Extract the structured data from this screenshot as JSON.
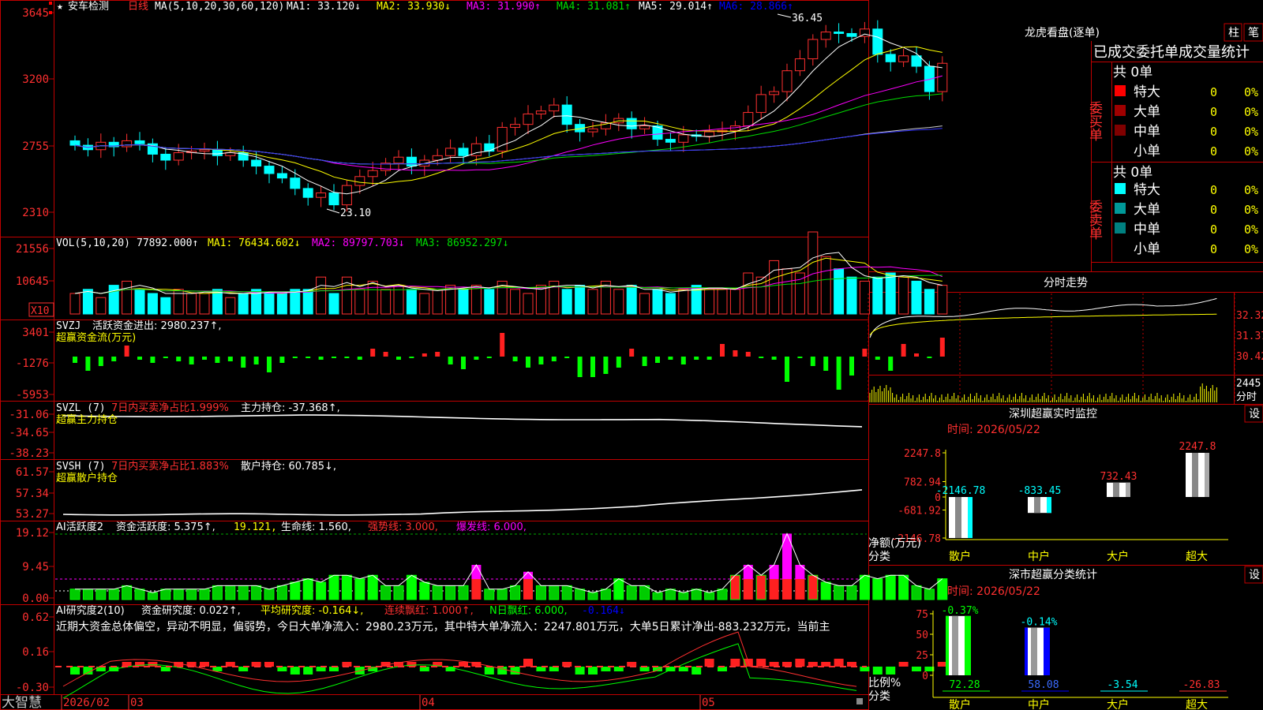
{
  "app": {
    "brand": "大智慧"
  },
  "kline": {
    "star": "★",
    "stock_name": "安车检测",
    "period": "日线",
    "ma_params": "MA(5,10,20,30,60,120)",
    "ma_values": [
      "MA1: 33.120↓",
      "MA2: 33.930↓",
      "MA3: 31.990↑",
      "MA4: 31.081↑",
      "MA5: 29.014↑",
      "MA6: 28.866↑"
    ],
    "y_ticks": [
      "3645",
      "3200",
      "2755",
      "2310"
    ],
    "high_label": "36.45",
    "low_label": "23.10",
    "date_labels": [
      "2026/02",
      "03",
      "04",
      "05"
    ]
  },
  "vol": {
    "title": "VOL(5,10,20)",
    "value": "77892.000↑",
    "ma_values": [
      "MA1: 76434.602↓",
      "MA2: 89797.703↓",
      "MA3: 86952.297↓"
    ],
    "y_ticks": [
      "21556",
      "10645"
    ],
    "unit": "X10"
  },
  "svzj": {
    "title": "SVZJ",
    "label": "活跃资金进出: 2980.237↑,",
    "subtitle": "超赢资金流(万元)",
    "y_ticks": [
      "3401",
      "-1276",
      "-5953"
    ]
  },
  "svzl": {
    "title": "SVZL (7)",
    "ratio": "7日内买卖净占比1.999%",
    "hold": "主力持仓: -37.368↑,",
    "subtitle": "超赢主力持仓",
    "y_ticks": [
      "-31.06",
      "-34.65",
      "-38.23"
    ]
  },
  "svsh": {
    "title": "SVSH (7)",
    "ratio": "7日内买卖净占比1.883%",
    "hold": "散户持仓: 60.785↓,",
    "subtitle": "超赢散户持仓",
    "y_ticks": [
      "61.57",
      "57.34",
      "53.27"
    ]
  },
  "ai_active": {
    "title": "AI活跃度2",
    "label1": "资金活跃度: 5.375↑,",
    "label2": "19.121,",
    "label3": "生命线: 1.560,",
    "label4": "强势线: 3.000,",
    "label5": "爆发线: 6.000,",
    "y_ticks": [
      "19.12",
      "9.45",
      "0.00"
    ]
  },
  "ai_research": {
    "title": "AI研究度2(10)",
    "label1": "资金研究度: 0.022↑,",
    "label2": "平均研究度: -0.164↓,",
    "label3": "连续飘红: 1.000↑,",
    "label4": "N日飘红: 6.000,",
    "label5": "-0.164↓",
    "summary": "近期大资金总体偏空，异动不明显，偏弱势，今日大单净流入：2980.23万元，其中特大单净流入：2247.801万元，大单5日累计净出-883.232万元，当前主",
    "y_ticks": [
      "0.62",
      "0.16",
      "-0.30"
    ]
  },
  "longhu": {
    "title": "龙虎看盘(逐单)",
    "btn_bar": "柱",
    "btn_pen": "笔",
    "stats_title": "已成交委托单成交量统计",
    "buy_label": "委买单",
    "sell_label": "委卖单",
    "buy_total": "共 0单",
    "sell_total": "共 0单",
    "rows_buy": [
      {
        "name": "特大",
        "count": "0",
        "pct": "0%",
        "color": "#ff0000"
      },
      {
        "name": "大单",
        "count": "0",
        "pct": "0%",
        "color": "#a00000"
      },
      {
        "name": "中单",
        "count": "0",
        "pct": "0%",
        "color": "#800000"
      },
      {
        "name": "小单",
        "count": "0",
        "pct": "0%",
        "color": "#000000"
      }
    ],
    "rows_sell": [
      {
        "name": "特大",
        "count": "0",
        "pct": "0%",
        "color": "#00ffff"
      },
      {
        "name": "大单",
        "count": "0",
        "pct": "0%",
        "color": "#009999"
      },
      {
        "name": "中单",
        "count": "0",
        "pct": "0%",
        "color": "#008080"
      },
      {
        "name": "小单",
        "count": "0",
        "pct": "0%",
        "color": "#000000"
      }
    ]
  },
  "fenshi": {
    "title": "分时走势",
    "y_ticks": [
      "32.32",
      "31.37",
      "30.42"
    ],
    "vol_tick": "2445",
    "vol_unit": "分时"
  },
  "monitor": {
    "title": "深圳超赢实时监控",
    "btn": "设",
    "time": "时间: 2026/05/22",
    "y_ticks": [
      "2247.8",
      "782.94",
      "0",
      "-681.92",
      "-2146.78"
    ],
    "y_label": "净额(万元)",
    "x_label": "分类",
    "categories": [
      "散户",
      "中户",
      "大户",
      "超大"
    ],
    "values": [
      -2146.78,
      -833.45,
      732.43,
      2247.8
    ],
    "value_labels": [
      "-2146.78",
      "-833.45",
      "732.43",
      "2247.8"
    ]
  },
  "classify": {
    "title": "深市超赢分类统计",
    "btn": "设",
    "time": "时间: 2026/05/22",
    "y_ticks": [
      "75",
      "50",
      "25",
      "0"
    ],
    "y_label": "比例%",
    "x_label": "分类",
    "categories": [
      "散户",
      "中户",
      "大户",
      "超大"
    ],
    "values": [
      72.28,
      58.08,
      -3.54,
      -26.83
    ],
    "value_labels": [
      "72.28",
      "58.08",
      "-3.54",
      "-26.83"
    ],
    "top_labels": [
      "-0.37%",
      "-0.14%"
    ]
  },
  "chart_data": [
    {
      "type": "bar",
      "title": "深圳超赢实时监控",
      "ylabel": "净额(万元)",
      "xlabel": "分类",
      "categories": [
        "散户",
        "中户",
        "大户",
        "超大"
      ],
      "values": [
        -2146.78,
        -833.45,
        732.43,
        2247.8
      ],
      "ylim": [
        -2146.78,
        2247.8
      ]
    },
    {
      "type": "bar",
      "title": "深市超赢分类统计",
      "ylabel": "比例%",
      "xlabel": "分类",
      "categories": [
        "散户",
        "中户",
        "大户",
        "超大"
      ],
      "values": [
        72.28,
        58.08,
        -3.54,
        -26.83
      ],
      "ylim": [
        0,
        75
      ]
    }
  ]
}
